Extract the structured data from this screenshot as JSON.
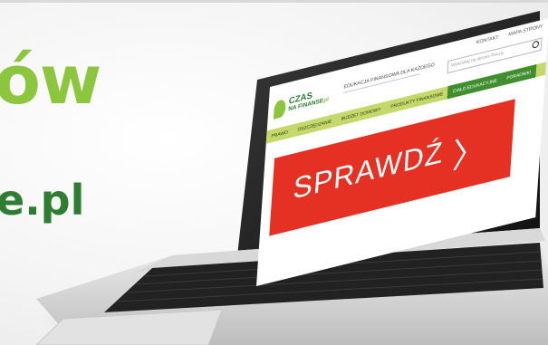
{
  "hero": {
    "headline_fragment": "ów",
    "domain_fragment": "e.pl"
  },
  "site": {
    "logo_line1": "CZAS",
    "logo_line2": "NA FINANSE",
    "logo_suffix": ".pl",
    "tagline": "EDUKACJA FINANSOWA DLA KAŻDEGO",
    "topbar_links": [
      "KONTAKT",
      "MAPA STRONY"
    ],
    "search_placeholder": "Wyszukaj na stronie Począ",
    "nav": [
      "PRAWO",
      "OSZCZĘDZANIE",
      "BUDŻET DOMOWY",
      "PRODUKTY FINANSOWE",
      "CIAŁO EDUKACYJNE",
      "PORADNIKI"
    ],
    "cta_label": "SPRAWDŹ",
    "cta_arrow": "〉"
  },
  "colors": {
    "headline_green": "#8cc63f",
    "domain_green": "#2e7d32",
    "cta_red": "#e53124",
    "nav_green": "#3f8f2f",
    "nav_light": "#c5d96b"
  }
}
